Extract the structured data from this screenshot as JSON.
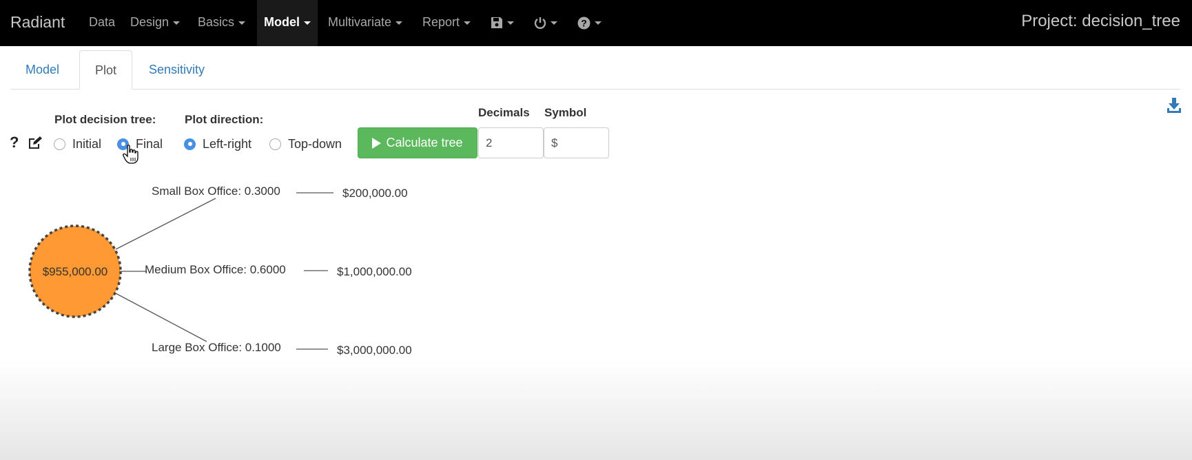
{
  "navbar": {
    "brand": "Radiant",
    "items": [
      {
        "label": "Data",
        "caret": false
      },
      {
        "label": "Design",
        "caret": true
      },
      {
        "label": "Basics",
        "caret": true
      },
      {
        "label": "Model",
        "caret": true,
        "active": true
      },
      {
        "label": "Multivariate",
        "caret": true
      },
      {
        "label": "Report",
        "caret": true
      }
    ],
    "icon_menus": [
      "save-icon",
      "power-icon",
      "help-icon"
    ],
    "project": "Project: decision_tree"
  },
  "tabs": [
    {
      "label": "Model"
    },
    {
      "label": "Plot",
      "active": true
    },
    {
      "label": "Sensitivity"
    }
  ],
  "controls": {
    "help_glyph": "?",
    "plot_tree_label": "Plot decision tree:",
    "plot_tree_options": [
      "Initial",
      "Final"
    ],
    "plot_tree_selected": "Final",
    "direction_label": "Plot direction:",
    "direction_options": [
      "Left-right",
      "Top-down"
    ],
    "direction_selected": "Left-right",
    "calculate_label": "Calculate tree",
    "decimals_label": "Decimals",
    "decimals_value": "2",
    "symbol_label": "Symbol",
    "symbol_value": "$"
  },
  "tree": {
    "root_value": "$955,000.00",
    "root_color": "#ff9933",
    "branches": [
      {
        "label": "Small Box Office: 0.3000",
        "payoff": "$200,000.00"
      },
      {
        "label": "Medium Box Office: 0.6000",
        "payoff": "$1,000,000.00"
      },
      {
        "label": "Large Box Office: 0.1000",
        "payoff": "$3,000,000.00"
      }
    ]
  },
  "colors": {
    "accent": "#337ab7",
    "button": "#5cb85c",
    "radio_checked": "#4a90e2",
    "navbar": "#000000"
  }
}
